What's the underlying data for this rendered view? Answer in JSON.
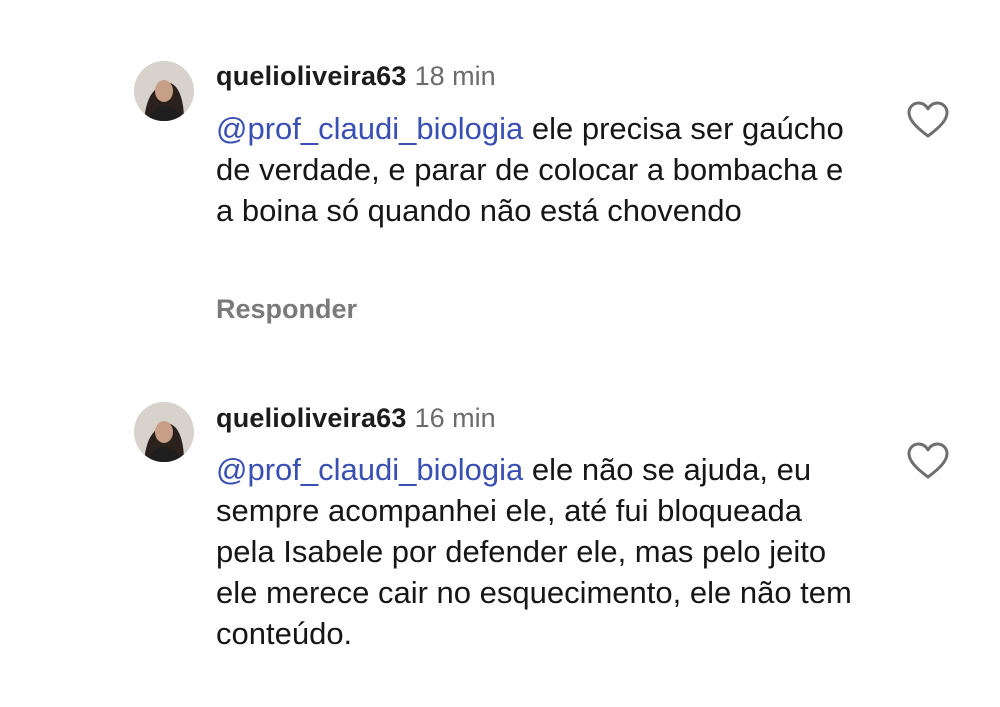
{
  "comments": [
    {
      "username": "quelioliveira63",
      "time": "18 min",
      "mention": "@prof_claudi_biologia",
      "text": " ele precisa ser gaúcho de verdade, e parar de colocar a bombacha e a boina só quando não está chovendo",
      "reply_label": "Responder",
      "like_icon": "heart-outline-icon"
    },
    {
      "username": "quelioliveira63",
      "time": "16 min",
      "mention": "@prof_claudi_biologia",
      "text": " ele não se ajuda, eu sempre acompanhei ele, até fui bloqueada pela Isabele por defender ele, mas pelo jeito ele merece cair no esquecimento, ele não tem conteúdo."
    }
  ],
  "colors": {
    "mention": "#3a4fb3",
    "time": "#6b6b6b",
    "reply": "#7a7a7a"
  }
}
